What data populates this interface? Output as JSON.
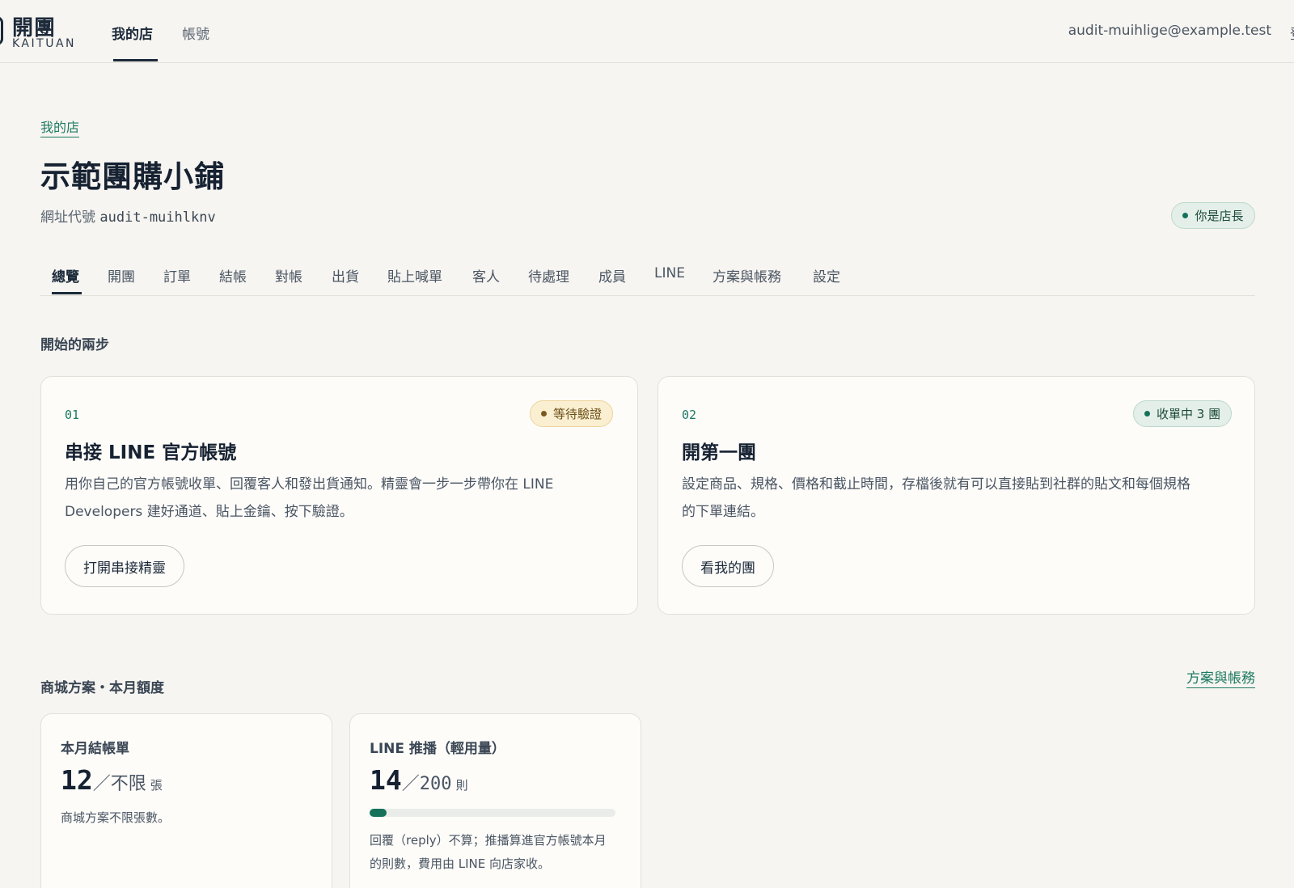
{
  "brand": {
    "name": "開團",
    "sub": "KAITUAN"
  },
  "topnav": {
    "items": [
      "我的店",
      "帳號"
    ],
    "active": 0
  },
  "user": {
    "email": "audit-muihlige@example.test",
    "edge_glyph": "登"
  },
  "breadcrumb": "我的店",
  "store": {
    "name": "示範團購小鋪",
    "slug_label": "網址代號",
    "slug": "audit-muihlknv",
    "role_badge": "你是店長"
  },
  "tabs": [
    "總覽",
    "開團",
    "訂單",
    "結帳",
    "對帳",
    "出貨",
    "貼上喊單",
    "客人",
    "待處理",
    "成員",
    "LINE",
    "方案與帳務",
    "設定"
  ],
  "steps_section": {
    "title": "開始的兩步",
    "cards": [
      {
        "num": "01",
        "title": "串接 LINE 官方帳號",
        "desc_lines": [
          "用你自己的官方帳號收單、回覆客人和發出貨通知。精靈會一步一步帶你在 LINE",
          "Developers 建好通道、貼上金鑰、按下驗證。"
        ],
        "button": "打開串接精靈",
        "status": "等待驗證"
      },
      {
        "num": "02",
        "title": "開第一團",
        "desc_lines": [
          "設定商品、規格、價格和截止時間，存檔後就有可以直接貼到社群的貼文和每個規格",
          "的下單連結。"
        ],
        "button": "看我的團",
        "status": "收單中 3 團"
      }
    ]
  },
  "plan_section": {
    "title": "商城方案・本月額度",
    "link": "方案與帳務",
    "cards": [
      {
        "title": "本月結帳單",
        "value": "12",
        "sep": "／",
        "limit": "不限",
        "unit": "張",
        "note_lines": [
          "商城方案不限張數。"
        ]
      },
      {
        "title": "LINE 推播（輕用量）",
        "value": "14",
        "sep": "／",
        "limit": "200",
        "unit": "則",
        "usage_fraction": 0.07,
        "note_lines": [
          "回覆（reply）不算；推播算進官方帳號本月",
          "的則數，費用由 LINE 向店家收。"
        ]
      }
    ]
  },
  "colors": {
    "accent": "#1d7a62",
    "ink": "#162232",
    "bg": "#f7f5f1",
    "amber": "#fbefd2"
  }
}
